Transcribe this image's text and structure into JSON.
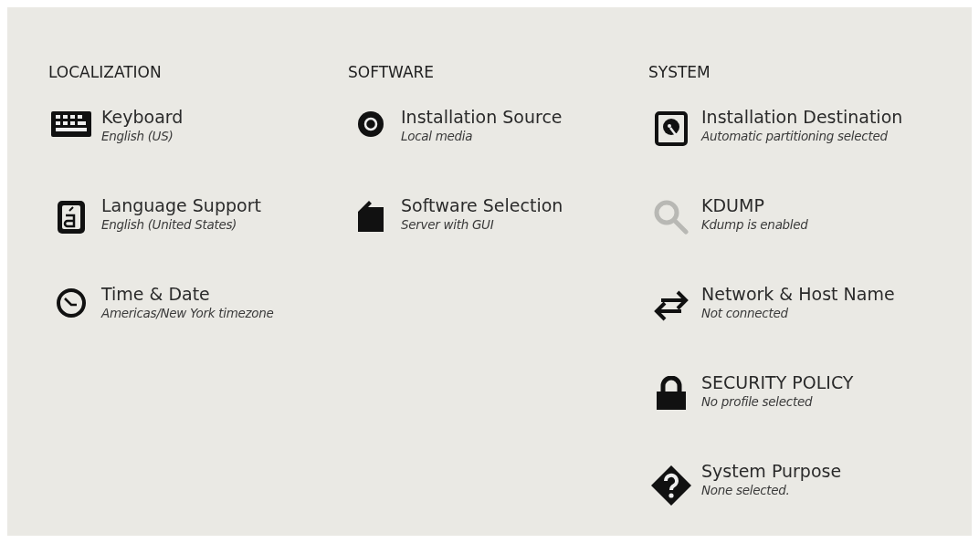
{
  "sections": [
    {
      "heading": "LOCALIZATION",
      "items": [
        {
          "kind": "keyboard",
          "title": "Keyboard",
          "status": "English (US)",
          "dimmed": false
        },
        {
          "kind": "language",
          "title": "Language Support",
          "status": "English (United States)",
          "dimmed": false
        },
        {
          "kind": "clock",
          "title": "Time & Date",
          "status": "Americas/New York timezone",
          "dimmed": false
        }
      ]
    },
    {
      "heading": "SOFTWARE",
      "items": [
        {
          "kind": "disc",
          "title": "Installation Source",
          "status": "Local media",
          "dimmed": false
        },
        {
          "kind": "package",
          "title": "Software Selection",
          "status": "Server with GUI",
          "dimmed": false
        }
      ]
    },
    {
      "heading": "SYSTEM",
      "items": [
        {
          "kind": "disk",
          "title": "Installation Destination",
          "status": "Automatic partitioning selected",
          "dimmed": false
        },
        {
          "kind": "search",
          "title": "KDUMP",
          "status": "Kdump is enabled",
          "dimmed": true
        },
        {
          "kind": "network",
          "title": "Network & Host Name",
          "status": "Not connected",
          "dimmed": false
        },
        {
          "kind": "lock",
          "title": "SECURITY POLICY",
          "status": "No profile selected",
          "dimmed": false
        },
        {
          "kind": "question",
          "title": "System Purpose",
          "status": "None selected.",
          "dimmed": false
        }
      ]
    }
  ]
}
